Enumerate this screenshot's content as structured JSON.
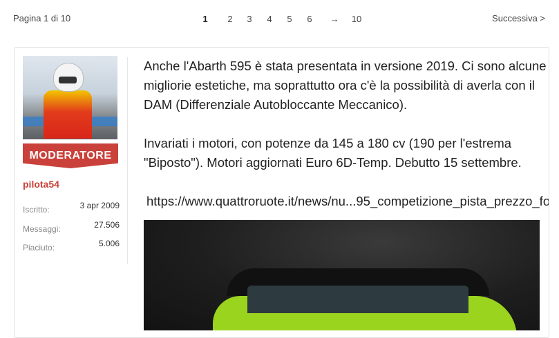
{
  "pagination": {
    "summary": "Pagina 1 di 10",
    "pages": [
      "1",
      "2",
      "3",
      "4",
      "5",
      "6",
      "→",
      "10"
    ],
    "current": "1",
    "next_label": "Successiva >"
  },
  "user": {
    "badge": "MODERATORE",
    "username": "pilota54",
    "stats": [
      {
        "label": "Iscritto:",
        "value": "3 apr 2009"
      },
      {
        "label": "Messaggi:",
        "value": "27.506"
      },
      {
        "label": "Piaciuto:",
        "value": "5.006"
      }
    ]
  },
  "post": {
    "paragraph1": "Anche l'Abarth 595 è stata presentata in versione 2019. Ci sono alcune migliorie estetiche, ma soprattutto ora c'è la possibilità di averla con il DAM (Differenziale Autobloccante Meccanico).",
    "paragraph2": "Invariati i motori, con potenze da 145 a 180 cv (190 per l'estrema \"Biposto\"). Motori aggiornati Euro 6D-Temp. Debutto 15 settembre.",
    "link": "https://www.quattroruote.it/news/nu...95_competizione_pista_prezzo_fo"
  },
  "colors": {
    "accent": "#c9413a"
  }
}
